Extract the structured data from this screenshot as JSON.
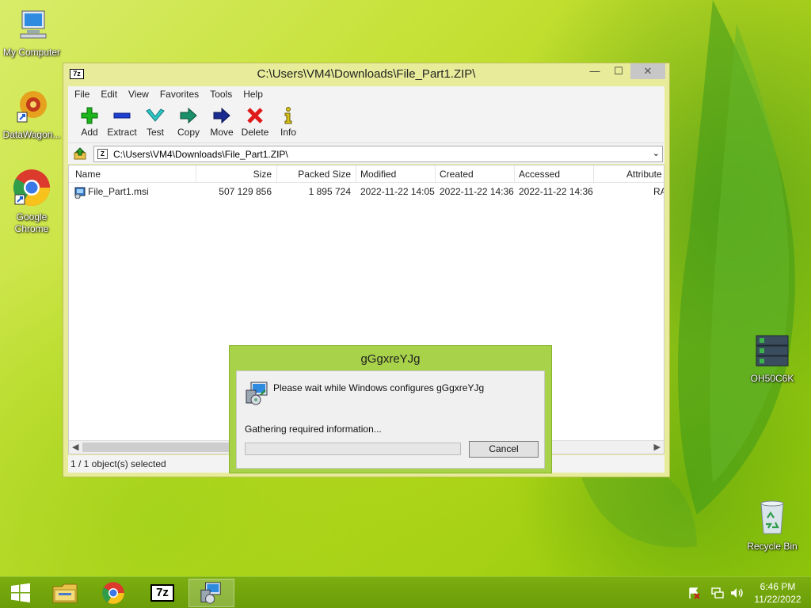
{
  "desktop": {
    "icons": [
      {
        "label": "My Computer"
      },
      {
        "label": "DataWagon..."
      },
      {
        "label": "Google Chrome"
      },
      {
        "label": "OH50C6K"
      },
      {
        "label": "Recycle Bin"
      }
    ]
  },
  "archive_window": {
    "title": "C:\\Users\\VM4\\Downloads\\File_Part1.ZIP\\",
    "logo": "7z",
    "controls": {
      "minimize": "—",
      "maximize": "☐",
      "close": "✕"
    },
    "menu": [
      "File",
      "Edit",
      "View",
      "Favorites",
      "Tools",
      "Help"
    ],
    "toolbar": [
      "Add",
      "Extract",
      "Test",
      "Copy",
      "Move",
      "Delete",
      "Info"
    ],
    "address": "C:\\Users\\VM4\\Downloads\\File_Part1.ZIP\\",
    "columns": [
      "Name",
      "Size",
      "Packed Size",
      "Modified",
      "Created",
      "Accessed",
      "Attribute"
    ],
    "rows": [
      {
        "name": "File_Part1.msi",
        "size": "507 129 856",
        "packed": "1 895 724",
        "modified": "2022-11-22 14:05",
        "created": "2022-11-22 14:36",
        "accessed": "2022-11-22 14:36",
        "attr": "RA"
      }
    ],
    "status": "1 / 1 object(s) selected"
  },
  "installer_dialog": {
    "title": "gGgxreYJg",
    "message": "Please wait while Windows configures gGgxreYJg",
    "status": "Gathering required information...",
    "progress": 0,
    "cancel_label": "Cancel"
  },
  "taskbar": {
    "time": "6:46 PM",
    "date": "11/22/2022"
  }
}
